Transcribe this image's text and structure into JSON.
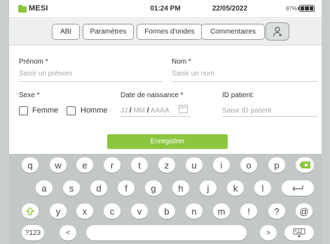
{
  "status_bar": {
    "brand": "MESI",
    "time": "01:24 PM",
    "date": "22/05/2022",
    "battery": "87%",
    "battery_level": 0.87,
    "brand_color": "#8cc63f"
  },
  "nav": {
    "abi": "ABI",
    "parametres": "Paramètres",
    "formes_ondes": "Formes d'ondes",
    "commentaires": "Commentaires",
    "patient_icon": "add-patient-icon"
  },
  "form": {
    "prenom_label": "Prénom *",
    "prenom_placeholder": "Saisir un prénom",
    "nom_label": "Nom *",
    "nom_placeholder": "Saisir un nom",
    "sexe_label": "Sexe *",
    "femme": "Femme",
    "homme": "Homme",
    "dob_label": "Date de naissance *",
    "dob_jj": "JJ",
    "dob_mm": "MM",
    "dob_aaaa": "AAAA",
    "dob_sep": "/",
    "id_label": "ID patient:",
    "id_placeholder": "Saisir ID patient",
    "save": "Enregistrer"
  },
  "keyboard": {
    "row1": [
      "q",
      "w",
      "e",
      "r",
      "t",
      "z",
      "u",
      "i",
      "o",
      "p"
    ],
    "row2": [
      "a",
      "s",
      "d",
      "f",
      "g",
      "h",
      "j",
      "k",
      "l"
    ],
    "row3": [
      "y",
      "x",
      "c",
      "v",
      "b",
      "n",
      "m",
      "!",
      "?",
      "@"
    ],
    "symbols": "?123",
    "prev": "<",
    "next": ">",
    "icons": {
      "backspace": "backspace-icon",
      "enter": "enter-icon",
      "shift": "shift-icon",
      "hide": "keyboard-hide-icon"
    }
  }
}
